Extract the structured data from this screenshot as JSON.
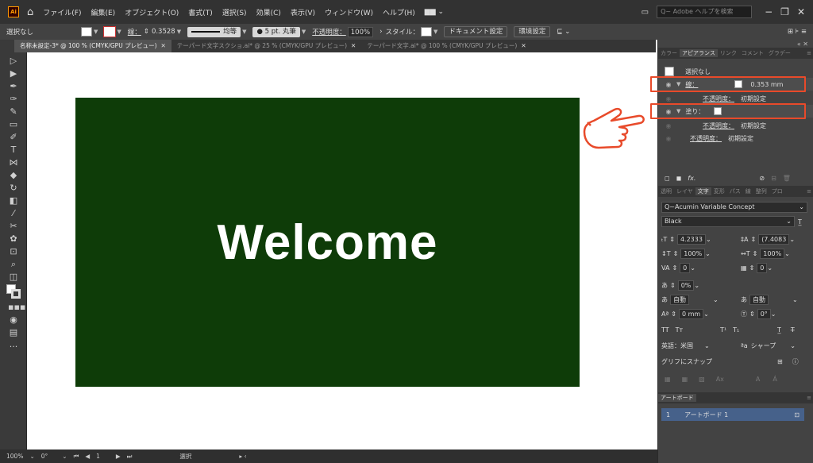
{
  "app": {
    "logo": "Ai"
  },
  "menu": [
    "ファイル(F)",
    "編集(E)",
    "オブジェクト(O)",
    "書式(T)",
    "選択(S)",
    "効果(C)",
    "表示(V)",
    "ウィンドウ(W)",
    "ヘルプ(H)"
  ],
  "search_placeholder": "Q~ Adobe ヘルプを検索",
  "control": {
    "selection": "選択なし",
    "stroke_label": "線：",
    "stroke_value": "0.3528",
    "stroke_profile": "均等",
    "brush": "5 pt. 丸筆",
    "opacity_label": "不透明度：",
    "opacity_value": "100%",
    "style_label": "スタイル：",
    "doc_setup": "ドキュメント設定",
    "prefs": "環境設定"
  },
  "tabs": [
    "名称未設定-3* @ 100 % (CMYK/GPU プレビュー)",
    "テーパード文字スクショ.ai* @ 25 % (CMYK/GPU プレビュー)",
    "テーパード文字.ai* @ 100 % (CMYK/GPU プレビュー)"
  ],
  "canvas": {
    "artboard_text": "Welcome",
    "artboard_color": "#0e3c08"
  },
  "status": {
    "zoom": "100%",
    "rotate": "0°",
    "page": "1",
    "mode": "選択"
  },
  "appearance": {
    "tabs": [
      "カラー",
      "アピアランス",
      "リンク",
      "コメント",
      "グラデー"
    ],
    "no_selection": "選択なし",
    "stroke_label": "線：",
    "stroke_value": "0.353 mm",
    "opacity_label": "不透明度：",
    "opacity_value": "初期設定",
    "fill_label": "塗り：",
    "fx": "fx."
  },
  "character": {
    "tabs": [
      "透明",
      "レイヤ",
      "文字",
      "変形",
      "パス",
      "線",
      "整列",
      "プロ"
    ],
    "font_family": "Acumin Variable Concept",
    "font_style": "Black",
    "size": "4.2333",
    "leading": "(7.4083",
    "vscale": "100%",
    "hscale": "100%",
    "kerning": "0",
    "tracking": "0",
    "tsume": "0%",
    "aki_before": "自動",
    "aki_after": "自動",
    "baseline": "0 mm",
    "rotation": "0°",
    "lang_label": "英語：米国",
    "aa": "シャープ",
    "glyph_snap": "グリフにスナップ"
  },
  "artboards": {
    "tab": "アートボード",
    "items": [
      {
        "num": "1",
        "name": "アートボード 1"
      }
    ]
  },
  "colors": {
    "accent_red": "#e84a2a",
    "selected_row": "#46618a"
  }
}
